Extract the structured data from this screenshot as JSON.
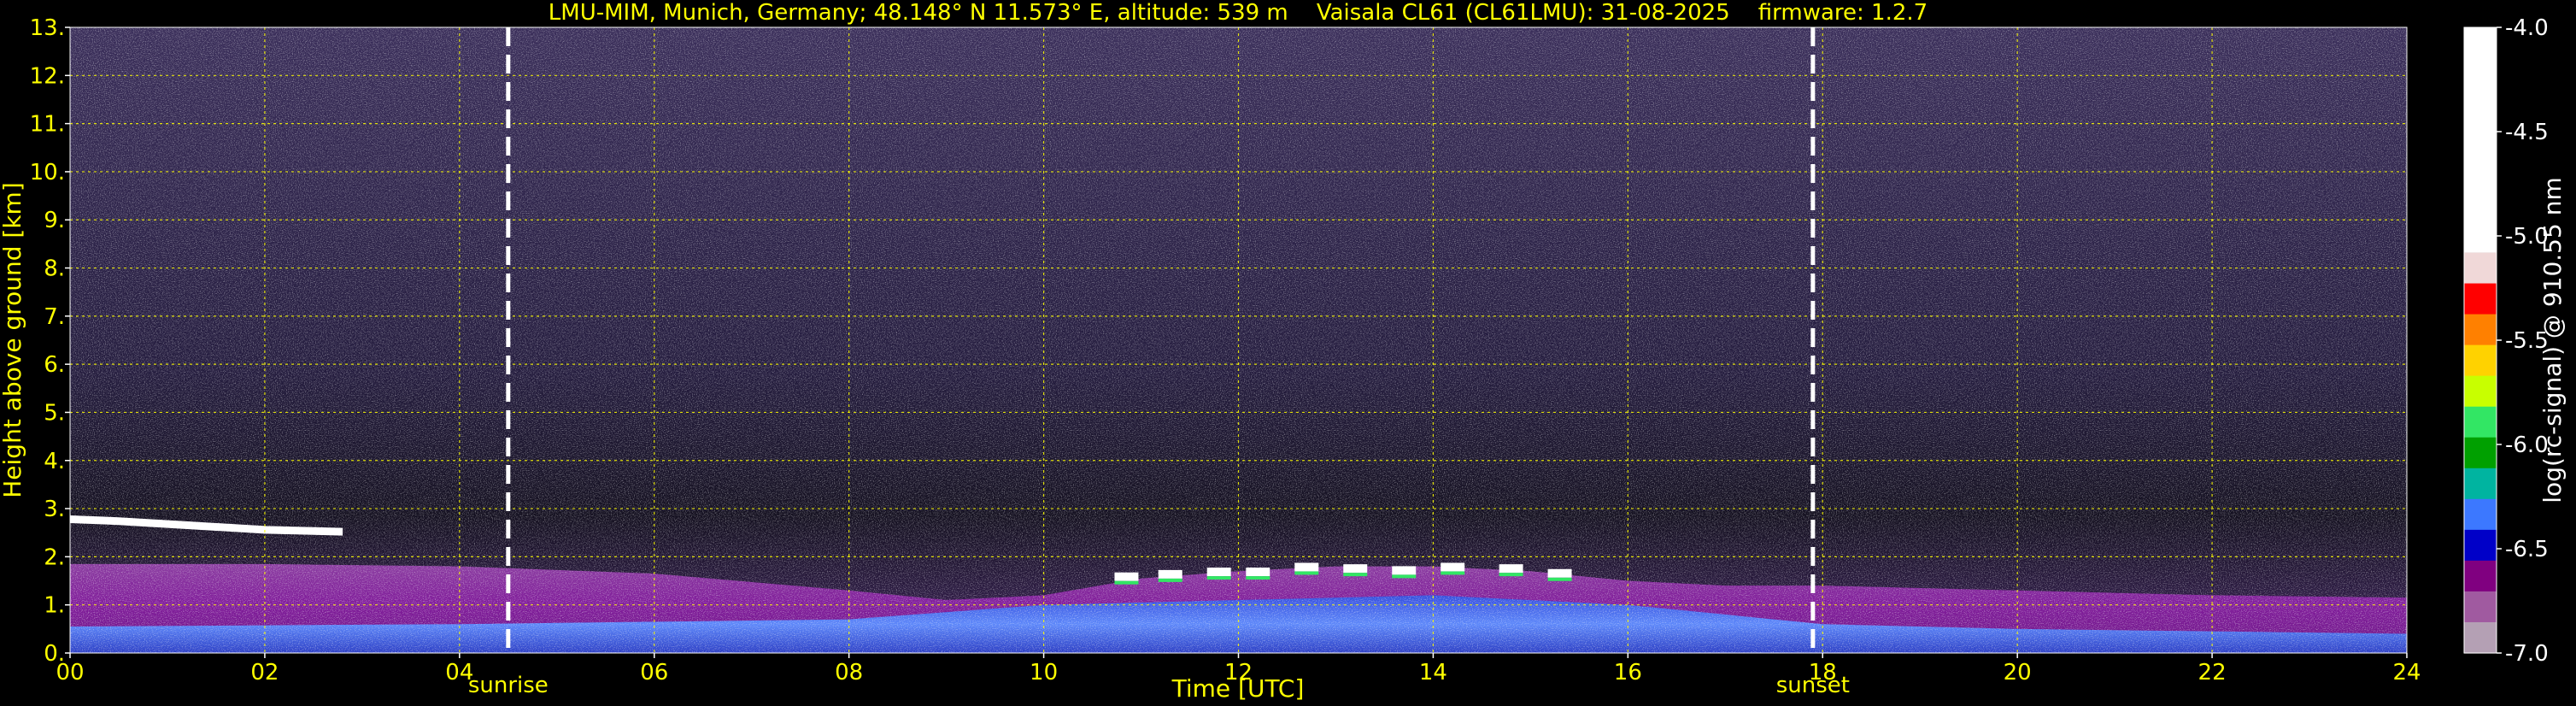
{
  "chart_data": {
    "type": "heatmap",
    "title": "LMU-MIM, Munich, Germany; 48.148° N 11.573° E, altitude: 539 m    Vaisala CL61 (CL61LMU): 31-08-2025    firmware: 1.2.7",
    "xlabel": "Time [UTC]",
    "ylabel": "Height above ground [km]",
    "xlim": [
      0,
      24
    ],
    "ylim": [
      0,
      13
    ],
    "x_ticks": [
      "00",
      "02",
      "04",
      "06",
      "08",
      "10",
      "12",
      "14",
      "16",
      "18",
      "20",
      "22",
      "24"
    ],
    "y_ticks": [
      "0.",
      "1.",
      "2.",
      "3.",
      "4.",
      "5.",
      "6.",
      "7.",
      "8.",
      "9.",
      "10.",
      "11.",
      "12.",
      "13."
    ],
    "grid": true,
    "events": [
      {
        "label": "sunrise",
        "x": 4.5
      },
      {
        "label": "sunset",
        "x": 17.9
      }
    ],
    "colorbar": {
      "label": "log(rc-signal) @ 910.55 nm",
      "ticks": [
        "-4.0",
        "-4.5",
        "-5.0",
        "-5.5",
        "-6.0",
        "-6.5",
        "-7.0"
      ],
      "range": [
        -7.0,
        -4.0
      ]
    },
    "features": {
      "residual_layer": [
        {
          "x": 0.0,
          "y": 2.78
        },
        {
          "x": 0.5,
          "y": 2.74
        },
        {
          "x": 1.0,
          "y": 2.68
        },
        {
          "x": 1.5,
          "y": 2.62
        },
        {
          "x": 2.0,
          "y": 2.56
        },
        {
          "x": 2.8,
          "y": 2.52
        }
      ],
      "boundary_layer_top": [
        {
          "x": 0,
          "y": 1.85
        },
        {
          "x": 2,
          "y": 1.85
        },
        {
          "x": 4,
          "y": 1.8
        },
        {
          "x": 6,
          "y": 1.65
        },
        {
          "x": 8,
          "y": 1.3
        },
        {
          "x": 9,
          "y": 1.1
        },
        {
          "x": 10,
          "y": 1.2
        },
        {
          "x": 11,
          "y": 1.55
        },
        {
          "x": 12,
          "y": 1.7
        },
        {
          "x": 13,
          "y": 1.8
        },
        {
          "x": 14,
          "y": 1.8
        },
        {
          "x": 15,
          "y": 1.7
        },
        {
          "x": 16,
          "y": 1.5
        },
        {
          "x": 17,
          "y": 1.4
        },
        {
          "x": 18,
          "y": 1.4
        },
        {
          "x": 20,
          "y": 1.3
        },
        {
          "x": 22,
          "y": 1.2
        },
        {
          "x": 24,
          "y": 1.15
        }
      ],
      "cumulus_cloud_base": [
        {
          "x": 10.85,
          "y": 1.55
        },
        {
          "x": 11.3,
          "y": 1.6
        },
        {
          "x": 11.8,
          "y": 1.65
        },
        {
          "x": 12.2,
          "y": 1.65
        },
        {
          "x": 12.7,
          "y": 1.75
        },
        {
          "x": 13.2,
          "y": 1.72
        },
        {
          "x": 13.7,
          "y": 1.68
        },
        {
          "x": 14.2,
          "y": 1.75
        },
        {
          "x": 14.8,
          "y": 1.72
        },
        {
          "x": 15.3,
          "y": 1.62
        }
      ],
      "near_surface_layer_top": [
        {
          "x": 0,
          "y": 0.55
        },
        {
          "x": 4,
          "y": 0.6
        },
        {
          "x": 8,
          "y": 0.7
        },
        {
          "x": 10,
          "y": 1.0
        },
        {
          "x": 12,
          "y": 1.1
        },
        {
          "x": 14,
          "y": 1.2
        },
        {
          "x": 16,
          "y": 1.0
        },
        {
          "x": 18,
          "y": 0.6
        },
        {
          "x": 20,
          "y": 0.5
        },
        {
          "x": 24,
          "y": 0.4
        }
      ]
    }
  },
  "colors": {
    "text": "#ffff00",
    "grid": "#ffff00",
    "background": "#000000",
    "colorbar_stops": [
      "#ffffff",
      "#f0d8d8",
      "#ff0000",
      "#ff8000",
      "#ffd200",
      "#c8ff00",
      "#32e664",
      "#00a000",
      "#00b4a0",
      "#3c78ff",
      "#0000c8",
      "#800080",
      "#a05aa0",
      "#b4a0b4"
    ]
  }
}
